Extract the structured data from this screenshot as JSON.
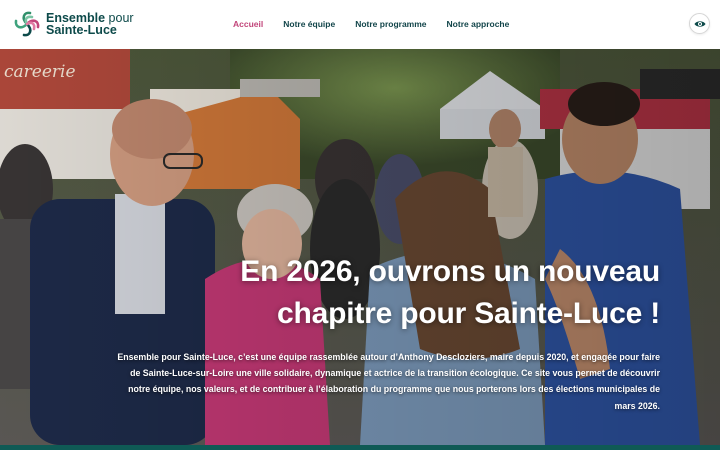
{
  "brand": {
    "name_line1_bold": "Ensemble",
    "name_line1_light": "pour",
    "name_line2": "Sainte-Luce",
    "logo_icon": "swirl-logo-icon",
    "colors": {
      "teal": "#0d4a4a",
      "pink": "#c2457a",
      "green": "#2f8f6a"
    }
  },
  "nav": {
    "items": [
      {
        "label": "Accueil",
        "active": true
      },
      {
        "label": "Notre équipe",
        "active": false
      },
      {
        "label": "Notre programme",
        "active": false
      },
      {
        "label": "Notre approche",
        "active": false
      }
    ]
  },
  "accessibility": {
    "icon": "eye-icon"
  },
  "hero": {
    "title": "En 2026, ouvrons un nouveau chapitre pour Sainte-Luce !",
    "description": "Ensemble pour Sainte-Luce, c’est une équipe rassemblée autour d’Anthony Descloziers, maire depuis 2020, et engagée pour faire de Sainte-Luce-sur-Loire une ville solidaire, dynamique et actrice de la transition écologique. Ce site vous permet de découvrir notre équipe, nos valeurs, et de contribuer à l’élaboration du programme que nous porterons lors des élections municipales de mars 2026.",
    "stall_sign": "careerie"
  }
}
